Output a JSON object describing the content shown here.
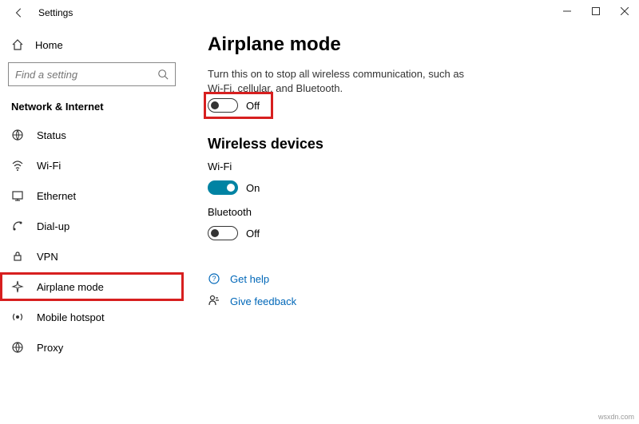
{
  "window": {
    "title": "Settings"
  },
  "sidebar": {
    "home": "Home",
    "search_placeholder": "Find a setting",
    "category": "Network & Internet",
    "items": [
      {
        "label": "Status"
      },
      {
        "label": "Wi-Fi"
      },
      {
        "label": "Ethernet"
      },
      {
        "label": "Dial-up"
      },
      {
        "label": "VPN"
      },
      {
        "label": "Airplane mode"
      },
      {
        "label": "Mobile hotspot"
      },
      {
        "label": "Proxy"
      }
    ]
  },
  "main": {
    "title": "Airplane mode",
    "description": "Turn this on to stop all wireless communication, such as Wi-Fi, cellular, and Bluetooth.",
    "airplane_state": "Off",
    "section": "Wireless devices",
    "wifi_label": "Wi-Fi",
    "wifi_state": "On",
    "bt_label": "Bluetooth",
    "bt_state": "Off",
    "help": "Get help",
    "feedback": "Give feedback"
  },
  "watermark": "wsxdn.com"
}
